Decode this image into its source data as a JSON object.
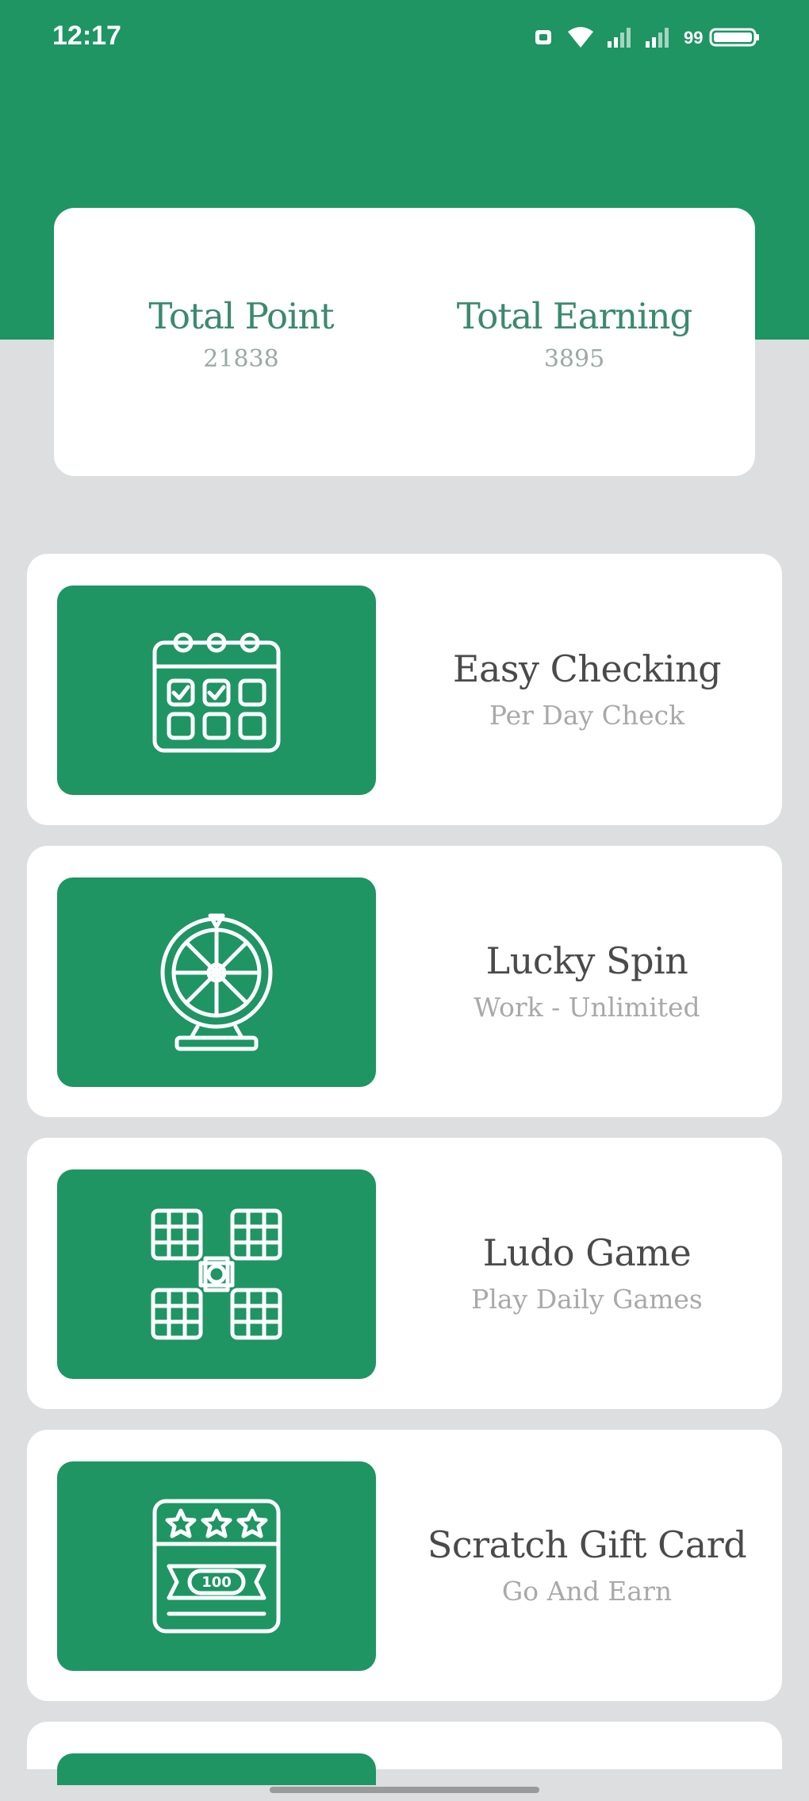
{
  "status_bar": {
    "time": "12:17",
    "battery_text": "99"
  },
  "stats": {
    "total_point_label": "Total Point",
    "total_point_value": "21838",
    "total_earning_label": "Total Earning",
    "total_earning_value": "3895"
  },
  "menu": [
    {
      "title": "Easy Checking",
      "subtitle": "Per Day Check",
      "icon": "calendar-icon"
    },
    {
      "title": "Lucky Spin",
      "subtitle": "Work - Unlimited",
      "icon": "spin-wheel-icon"
    },
    {
      "title": "Ludo Game",
      "subtitle": "Play Daily Games",
      "icon": "ludo-board-icon"
    },
    {
      "title": "Scratch Gift Card",
      "subtitle": "Go And Earn",
      "icon": "scratch-card-icon"
    }
  ],
  "colors": {
    "primary": "#1e9563",
    "background": "#dcdedf",
    "card": "#ffffff"
  }
}
